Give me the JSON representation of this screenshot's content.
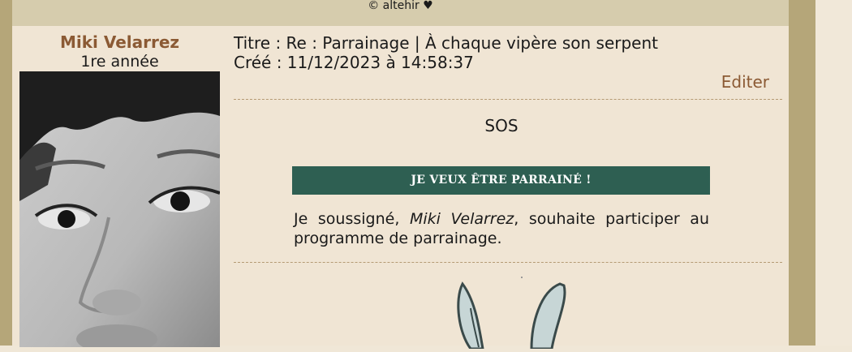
{
  "header": {
    "copyright": "© altehir ♥"
  },
  "author": {
    "name": "Miki Velarrez",
    "rank": "1re année"
  },
  "post": {
    "title": "Titre : Re : Parrainage | À chaque vipère son serpent",
    "created": "Créé : 11/12/2023 à 14:58:37",
    "edit_label": "Editer",
    "body_heading": "SOS",
    "banner": "JE VEUX ÊTRE PARRAINÉ !",
    "declaration_before": "Je soussigné, ",
    "declaration_name": "Miki Velarrez",
    "declaration_after": ", souhaite participer au programme de parrainage."
  },
  "colors": {
    "frame": "#b5a679",
    "topbar": "#d6ccad",
    "panel": "#f0e5d4",
    "accent_brown": "#8b5a34",
    "banner_green": "#2e5f52"
  },
  "icons": {
    "avatar": "avatar-photo",
    "illustration": "bunny-ears-illustration"
  }
}
